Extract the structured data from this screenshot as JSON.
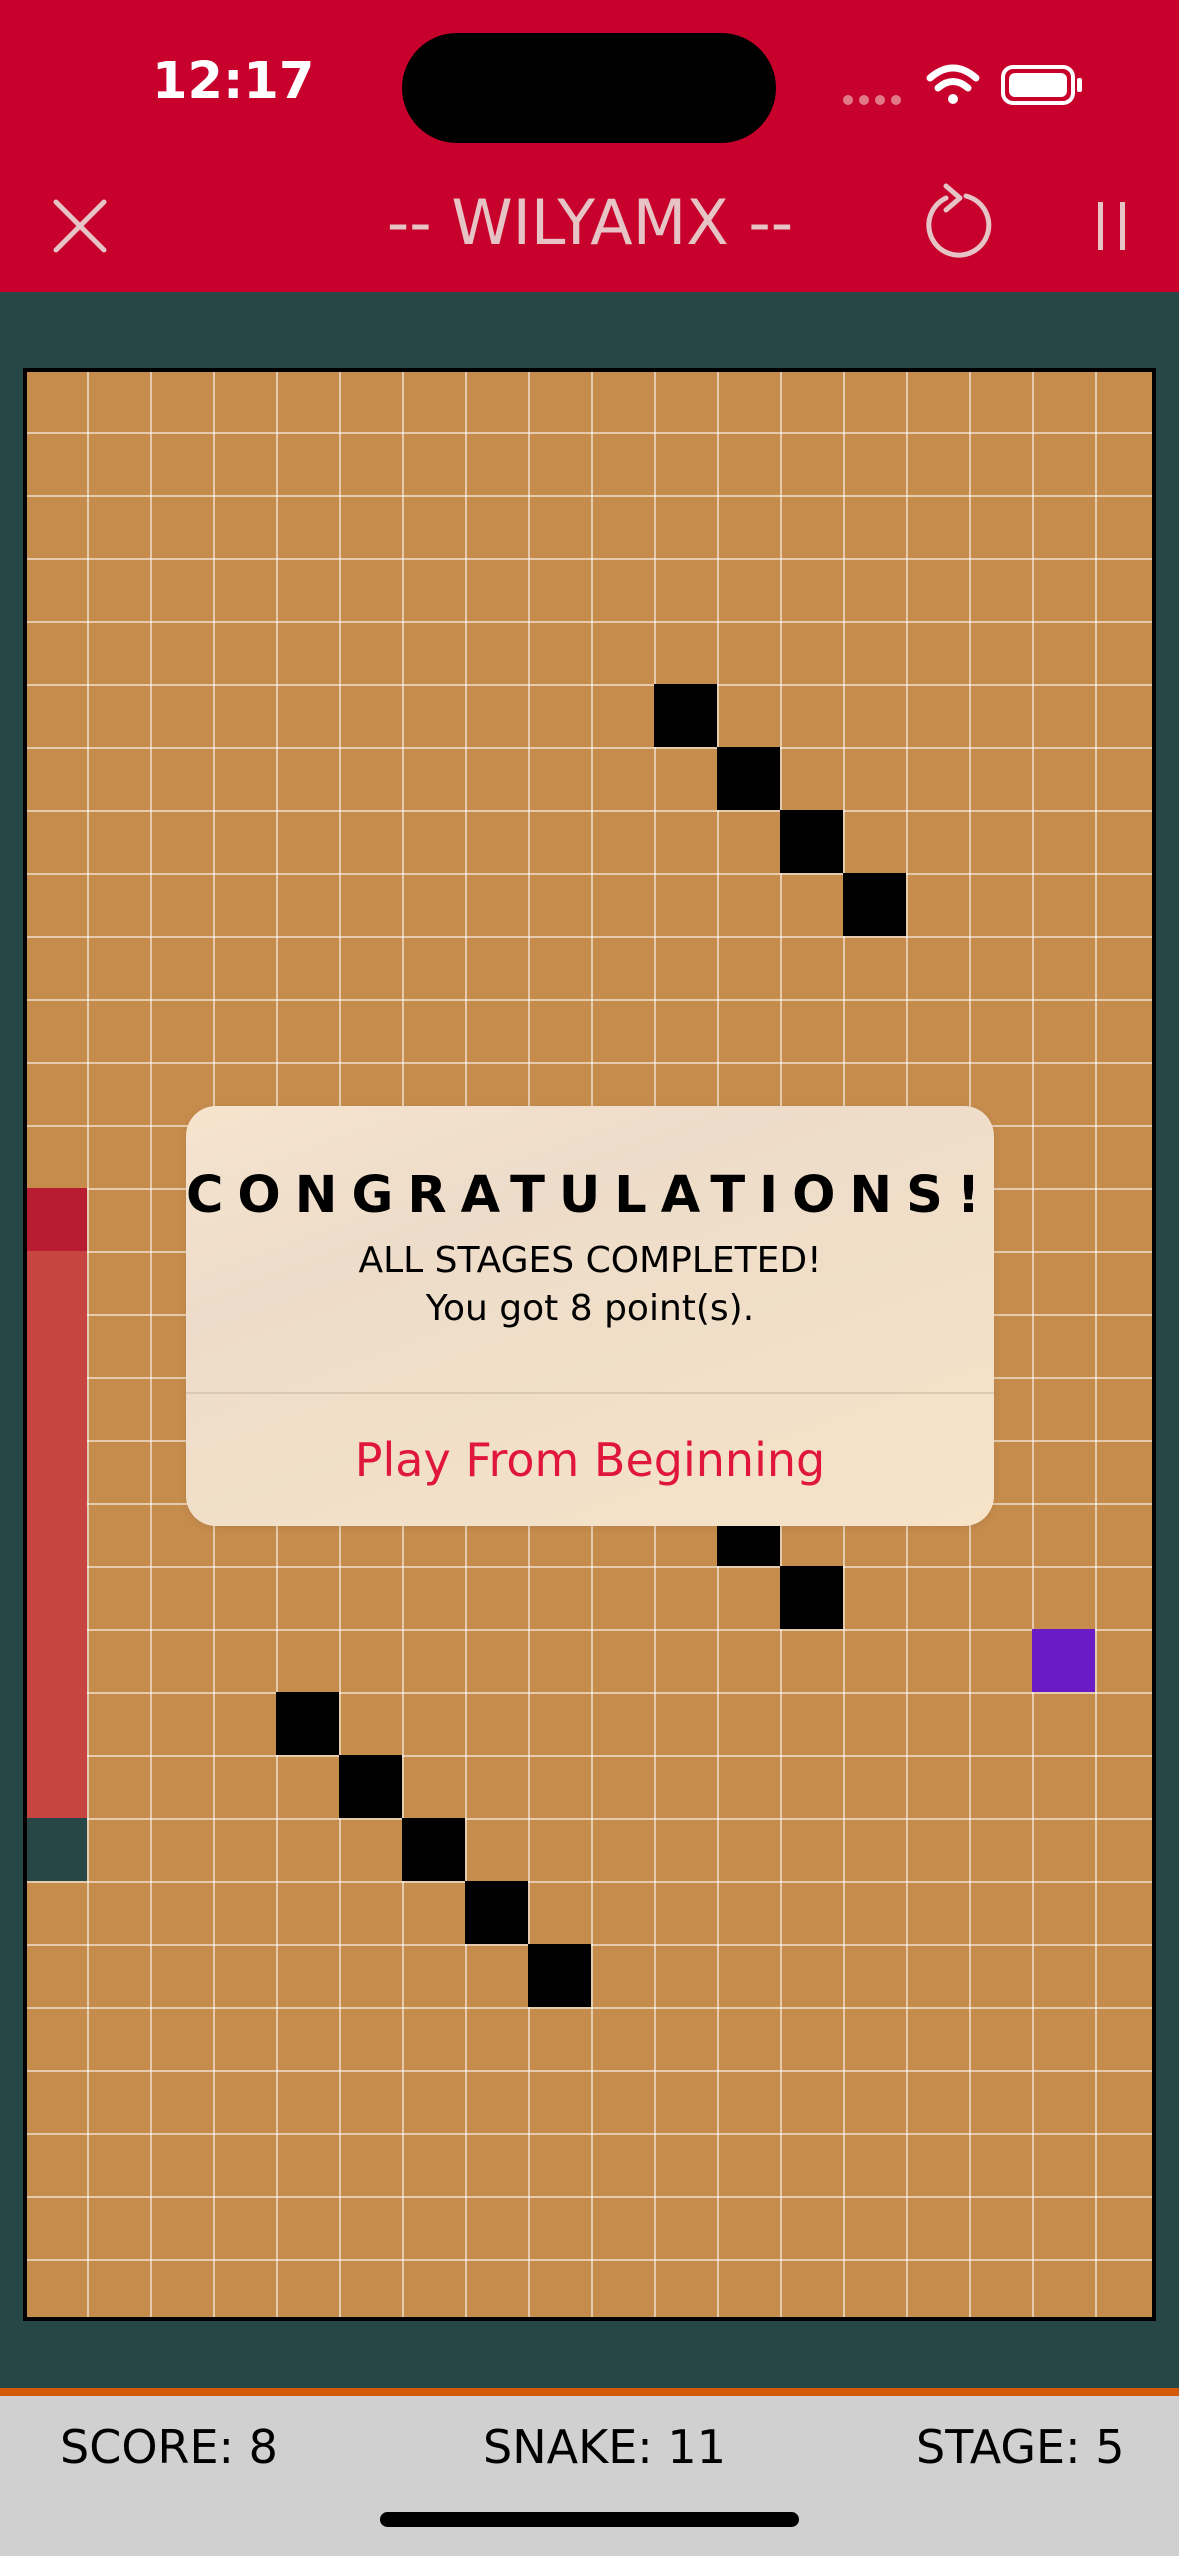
{
  "status_bar": {
    "time": "12:17",
    "icons": [
      "cellular-signal-icon",
      "wifi-icon",
      "battery-icon"
    ]
  },
  "nav": {
    "title": "-- WILYAMX --",
    "close_icon": "close-icon",
    "restart_icon": "restart-icon",
    "pause_icon": "pause-icon"
  },
  "board": {
    "columns": 18,
    "rows": 31,
    "walls": [
      [
        10,
        5
      ],
      [
        11,
        6
      ],
      [
        12,
        7
      ],
      [
        13,
        8
      ],
      [
        11,
        18
      ],
      [
        12,
        19
      ],
      [
        4,
        21
      ],
      [
        5,
        22
      ],
      [
        6,
        23
      ],
      [
        7,
        24
      ],
      [
        8,
        25
      ]
    ],
    "snake": {
      "head": [
        0,
        13
      ],
      "length": 11,
      "tail_marker": [
        0,
        23
      ]
    },
    "food": [
      16,
      20
    ]
  },
  "dialog": {
    "title": "CONGRATULATIONS!",
    "line1": "ALL STAGES COMPLETED!",
    "line2": "You got 8 point(s).",
    "button": "Play From Beginning"
  },
  "footer": {
    "score": "SCORE: 8",
    "snake": "SNAKE: 11",
    "stage": "STAGE: 5"
  },
  "colors": {
    "header": "#c8002c",
    "background": "#264746",
    "board": "#c68c4c",
    "wall": "#000000",
    "snake_body": "#c64540",
    "snake_head": "#b81c33",
    "food": "#6a1bc4",
    "accent_text": "#e0163c",
    "footer": "#d0d0d0",
    "footer_border": "#d25a0a"
  }
}
